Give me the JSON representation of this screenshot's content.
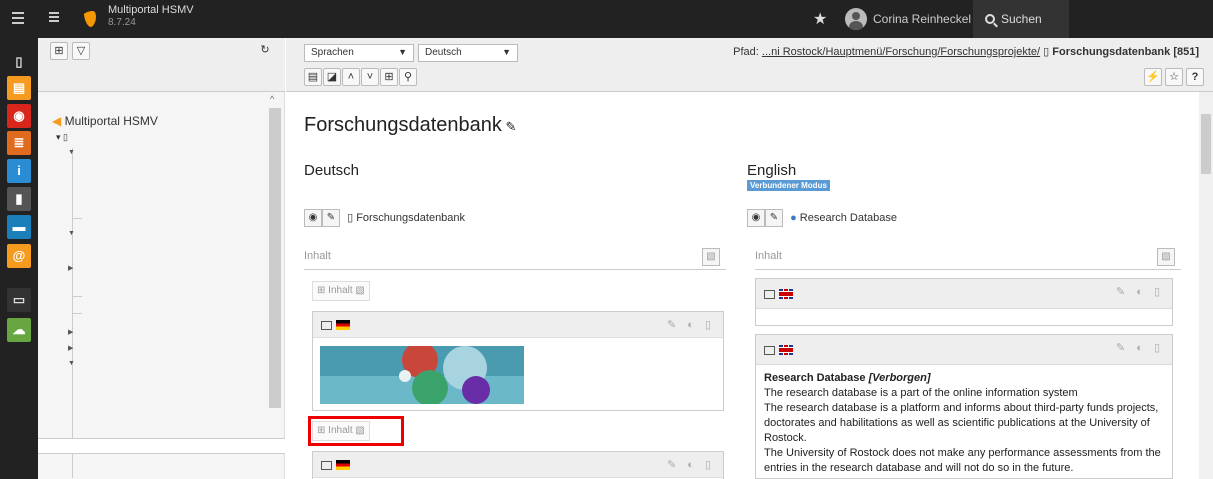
{
  "topbar": {
    "site_name": "Multiportal HSMV",
    "site_version": "8.7.24",
    "user_name": "Corina Reinheckel",
    "search_label": "Suchen"
  },
  "modules": [
    {
      "name": "page-module-icon",
      "color": "#333333",
      "glyph": "▯"
    },
    {
      "name": "list-module-icon",
      "color": "#f49b20",
      "glyph": "▤"
    },
    {
      "name": "view-module-icon",
      "color": "#d9261c",
      "glyph": "◉"
    },
    {
      "name": "info-module-icon",
      "color": "#e06a1d",
      "glyph": "≣"
    },
    {
      "name": "info-icon",
      "color": "#2a8dd4",
      "glyph": "i"
    },
    {
      "name": "trash-module-icon",
      "color": "#555555",
      "glyph": "🗑"
    },
    {
      "name": "briefcase-module-icon",
      "color": "#1b7fb9",
      "glyph": "▬"
    },
    {
      "name": "at-module-icon",
      "color": "#f49b20",
      "glyph": "@"
    },
    {
      "name": "image-module-icon",
      "color": "#444444",
      "glyph": "▭"
    },
    {
      "name": "cloud-module-icon",
      "color": "#68a641",
      "glyph": "☁"
    }
  ],
  "tree": {
    "root_label": "Multiportal HSMV"
  },
  "docheader": {
    "lang_select": "Sprachen",
    "lang_value": "Deutsch",
    "path_label": "Pfad:",
    "path_link": "...ni Rostock/Hauptmenü/Forschung/Forschungsprojekte/",
    "path_page": "Forschungsdatenbank [851]"
  },
  "content": {
    "title": "Forschungsdatenbank",
    "col_de": {
      "heading": "Deutsch",
      "page_title": "Forschungsdatenbank",
      "inhalt": "Inhalt",
      "new_inhalt": "Inhalt",
      "new_inhalt2": "Inhalt"
    },
    "col_en": {
      "heading": "English",
      "badge": "Verbundener Modus",
      "page_title": "Research Database",
      "inhalt": "Inhalt",
      "entry_title": "Research Database",
      "entry_hidden": "[Verborgen]",
      "entry_lines": [
        "The research database is a part of the online information system",
        "The research database is a platform and informs about third-party funds projects, doctorates and habilitations as well as scientific publications at the University of Rostock.",
        "The University of Rostock does not make any performance assessments from the entries in the research database and will not do so in the future."
      ]
    }
  }
}
